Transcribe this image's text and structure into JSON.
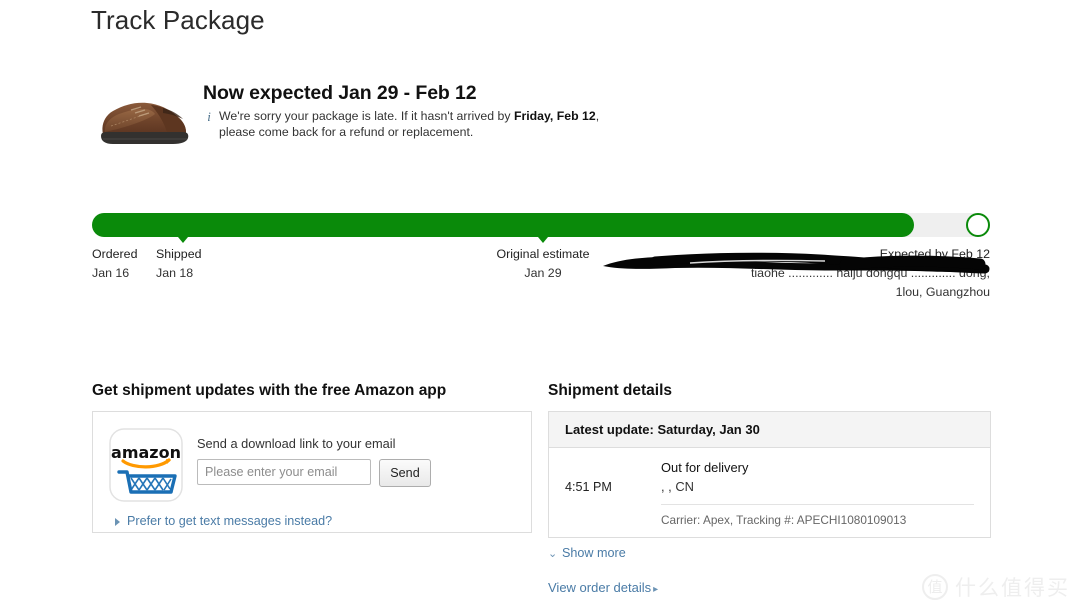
{
  "page": {
    "title": "Track Package"
  },
  "hero": {
    "product_icon": "brown-leather-shoe",
    "headline": "Now expected Jan 29 - Feb 12",
    "info_icon": "info-icon",
    "note_part1": "We're sorry your package is late. If it hasn't arrived by ",
    "note_bold": "Friday, Feb 12",
    "note_part2": ",",
    "note_line2": "please come back for a refund or replacement."
  },
  "tracker": {
    "progress_percent": 92,
    "fill_color": "#0a8a0a",
    "track_color": "#efefef",
    "stops": [
      {
        "label": "Ordered",
        "date": "Jan 16"
      },
      {
        "label": "Shipped",
        "date": "Jan 18"
      },
      {
        "label": "Original estimate",
        "date": "Jan 29"
      },
      {
        "label": "Expected by Feb 12",
        "date": ""
      }
    ],
    "address_redacted": "tiaohe ............. haiju dongqu ............. dong;",
    "address_visible": "1lou, Guangzhou"
  },
  "app_promo": {
    "heading": "Get shipment updates with the free Amazon app",
    "icon": "amazon-app-icon",
    "prompt": "Send a download link to your email",
    "email_placeholder": "Please enter your email",
    "email_value": "",
    "send_label": "Send",
    "text_link": "Prefer to get text messages instead?"
  },
  "shipment": {
    "heading": "Shipment details",
    "latest_update": "Latest update: Saturday, Jan 30",
    "events": [
      {
        "time": "4:51 PM",
        "status": "Out for delivery",
        "location": ", , CN",
        "carrier": "Carrier: Apex, Tracking #: APECHI1080109013"
      }
    ],
    "show_more": "Show more",
    "show_more_icon": "chevron-down-icon",
    "view_order": "View order details",
    "view_order_icon": "chevron-right-icon"
  },
  "watermark": {
    "mark": "值",
    "text": "什么值得买"
  }
}
